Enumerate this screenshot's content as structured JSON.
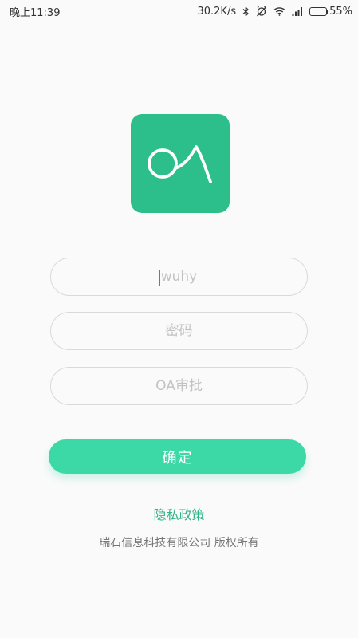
{
  "status_bar": {
    "time": "晚上11:39",
    "network_speed": "30.2K/s",
    "battery_percent": "55%",
    "battery_level": 0.55,
    "icons": [
      "bluetooth-icon",
      "alarm-off-icon",
      "wifi-icon",
      "signal-icon",
      "battery-icon"
    ]
  },
  "app": {
    "logo_text": "OA",
    "logo_color": "#2dbf8b"
  },
  "form": {
    "username": {
      "placeholder": "wuhy",
      "value": ""
    },
    "password": {
      "placeholder": "密码",
      "value": ""
    },
    "approval": {
      "placeholder": "OA审批",
      "value": ""
    },
    "confirm_label": "确定",
    "accent_color": "#3cd9a6"
  },
  "footer": {
    "privacy_link": "隐私政策",
    "copyright": "瑞石信息科技有限公司 版权所有"
  }
}
